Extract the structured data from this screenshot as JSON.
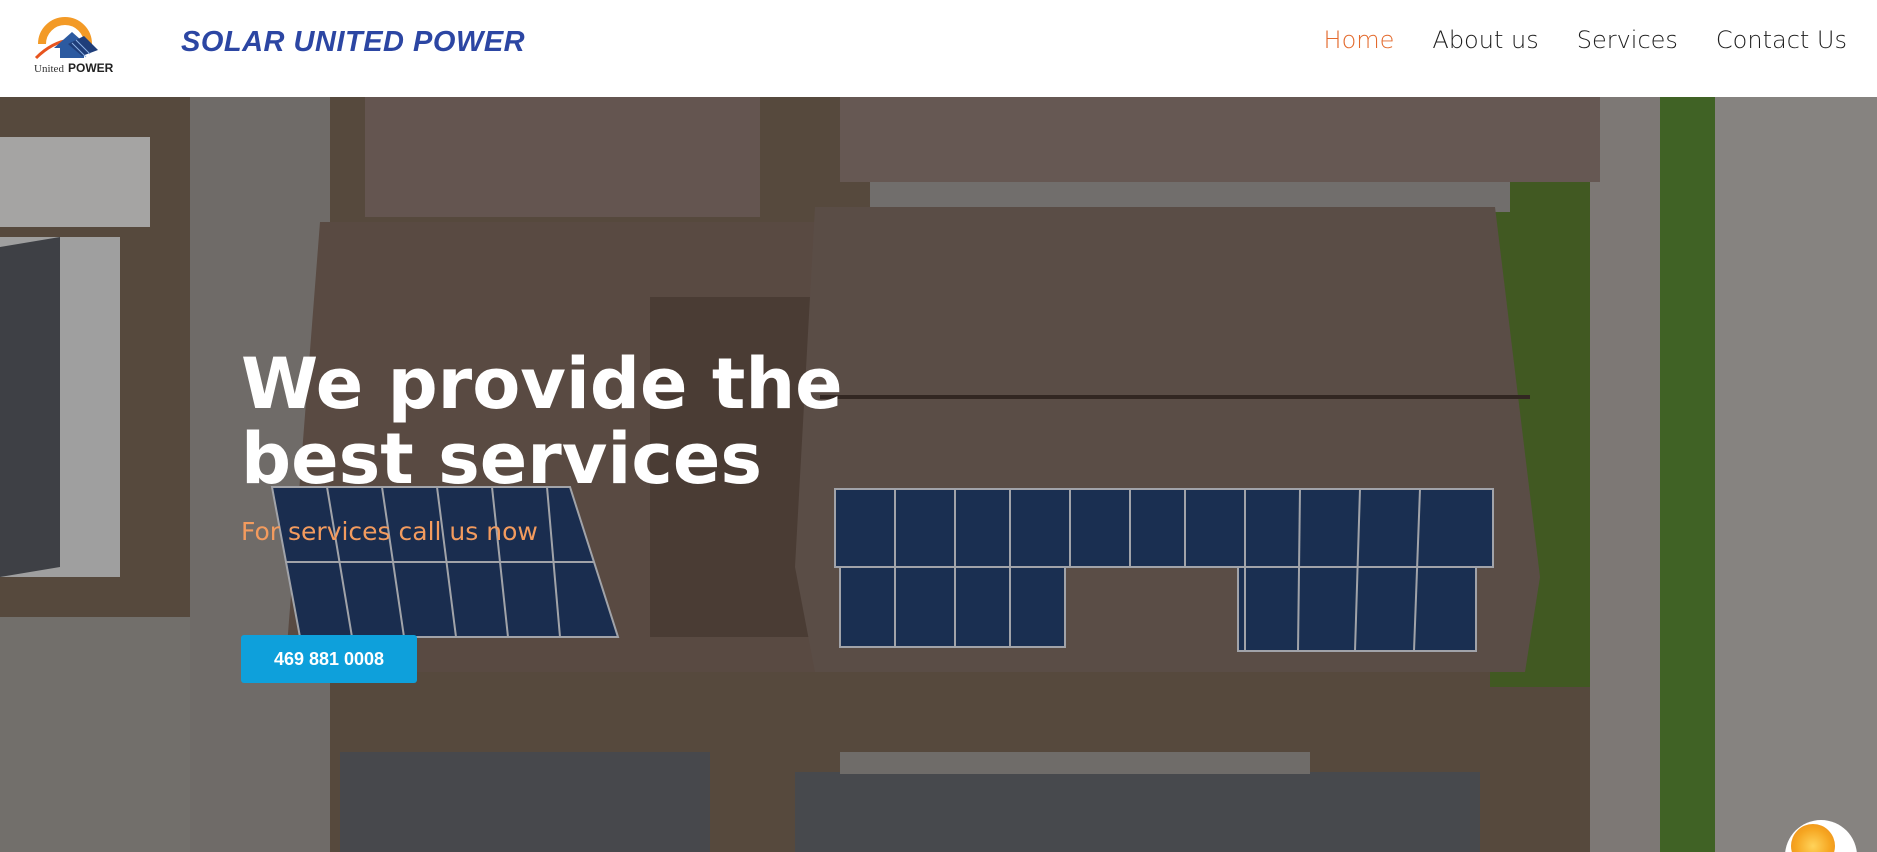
{
  "header": {
    "logo_icon": "united-power-logo",
    "logo_text": "United POWER",
    "brand": "SOLAR UNITED POWER"
  },
  "nav": {
    "items": [
      {
        "label": "Home",
        "active": true
      },
      {
        "label": "About us",
        "active": false
      },
      {
        "label": "Services",
        "active": false
      },
      {
        "label": "Contact Us",
        "active": false
      }
    ]
  },
  "hero": {
    "title": "We provide the best services",
    "subtitle": "For services call us now",
    "cta_label": "469 881 0008",
    "background": "aerial photo of house roofs with solar panels"
  },
  "colors": {
    "brand": "#2c46a3",
    "nav_active": "#e36a2d",
    "subtitle": "#f39b5e",
    "cta": "#0ea0db"
  },
  "floating": {
    "icon": "sun-chat-icon"
  }
}
